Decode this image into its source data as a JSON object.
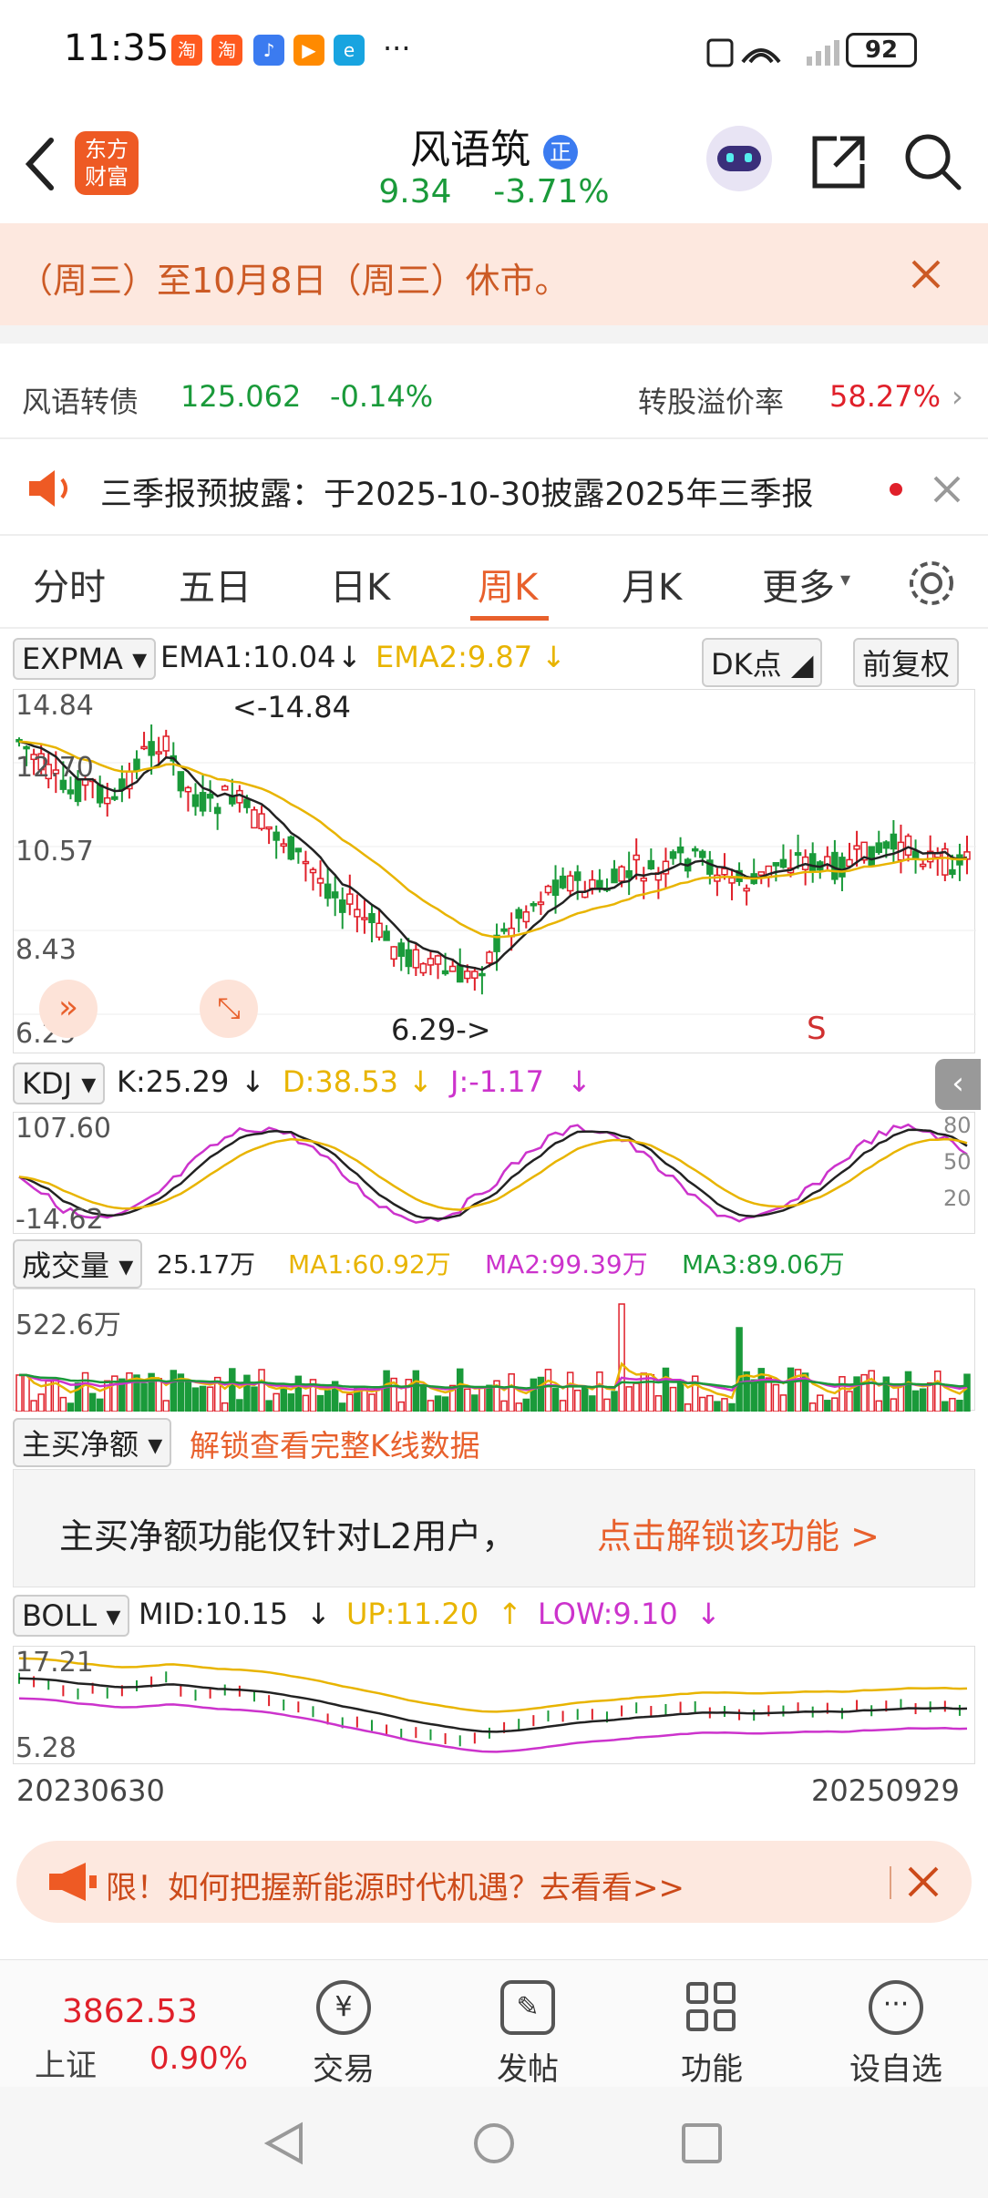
{
  "status_bar": {
    "time": "11:35",
    "battery": "92",
    "app_icons": [
      "taobao-icon",
      "taobao-icon",
      "music-icon",
      "video-icon",
      "browser-icon"
    ]
  },
  "header": {
    "logo_line1": "东方",
    "logo_line2": "财富",
    "stock_name": "风语筑",
    "badge": "正",
    "price": "9.34",
    "change_pct": "-3.71%"
  },
  "notice": {
    "text": "（周三）至10月8日（周三）休市。"
  },
  "bond": {
    "name": "风语转债",
    "price": "125.062",
    "change": "-0.14%",
    "premium_label": "转股溢价率",
    "premium_value": "58.27%"
  },
  "announcement": {
    "text": "三季报预披露：于2025-10-30披露2025年三季报"
  },
  "tabs": [
    "分时",
    "五日",
    "日K",
    "周K",
    "月K",
    "更多"
  ],
  "active_tab": "周K",
  "main_chart": {
    "indicator": "EXPMA",
    "ema1": "EMA1:10.04",
    "ema2": "EMA2:9.87",
    "dk_label": "DK点",
    "adjust_label": "前复权",
    "y_top": "14.84",
    "y_mid1": "12.70",
    "y_mid2": "10.57",
    "y_mid3": "8.43",
    "y_bottom": "6.29",
    "high_marker": "<-14.84",
    "low_marker": "6.29->",
    "sell_marker": "S"
  },
  "kdj": {
    "indicator": "KDJ",
    "k": "K:25.29",
    "d": "D:38.53",
    "j": "J:-1.17",
    "y_top": "107.60",
    "y_bottom": "-14.62",
    "levels": [
      "80",
      "50",
      "20"
    ]
  },
  "volume": {
    "indicator": "成交量",
    "value": "25.17万",
    "ma1": "MA1:60.92万",
    "ma2": "MA2:99.39万",
    "ma3": "MA3:89.06万",
    "y_top": "522.6万"
  },
  "net_buy": {
    "indicator": "主买净额",
    "unlock_link": "解锁查看完整K线数据",
    "panel_text": "主买净额功能仅针对L2用户，",
    "panel_link": "点击解锁该功能 >"
  },
  "boll": {
    "indicator": "BOLL",
    "mid": "MID:10.15",
    "up": "UP:11.20",
    "low": "LOW:9.10",
    "y_top": "17.21",
    "y_bottom": "5.28",
    "date_start": "20230630",
    "date_end": "20250929"
  },
  "promo": {
    "text": "限！如何把握新能源时代机遇？去看看>>"
  },
  "bottom_bar": {
    "index_value": "3862.53",
    "index_name": "上证",
    "index_change": "0.90%",
    "items": [
      "交易",
      "发帖",
      "功能",
      "设自选"
    ]
  },
  "colors": {
    "up": "#e0202a",
    "down": "#1a9a3a",
    "accent": "#e8602c",
    "ema2": "#e8b400",
    "j_line": "#cc33cc"
  }
}
